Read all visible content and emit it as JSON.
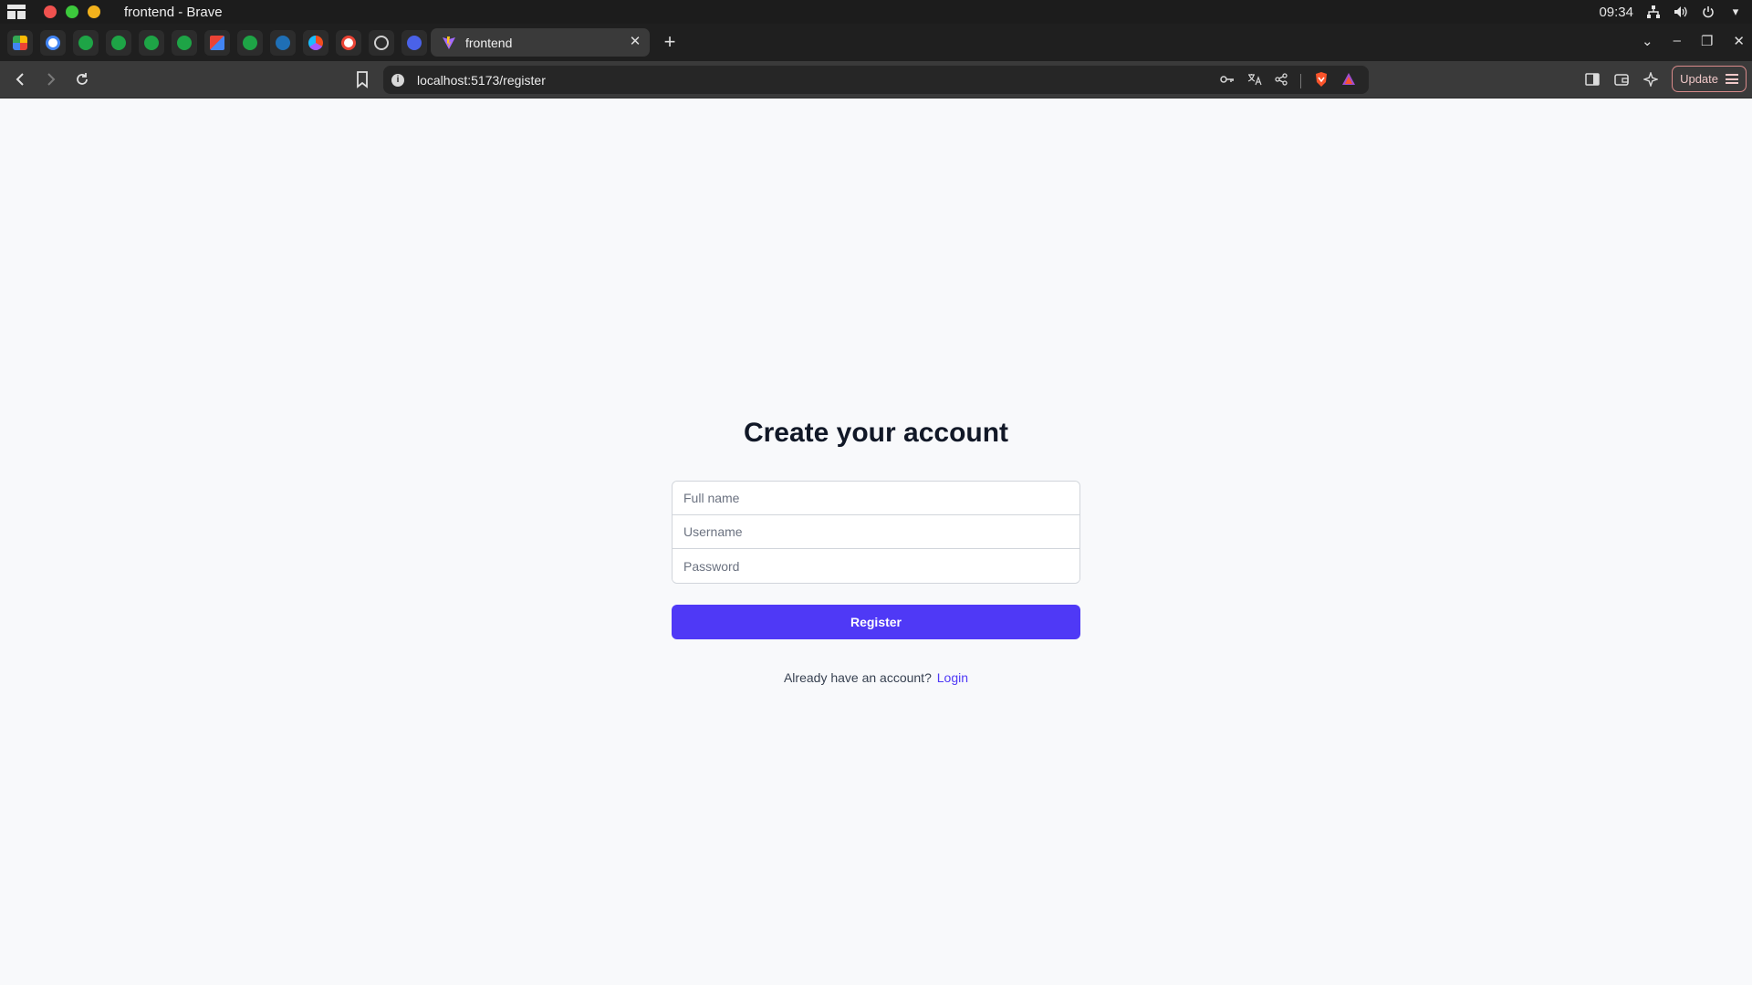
{
  "system": {
    "window_title": "frontend - Brave",
    "clock": "09:34"
  },
  "tabs": {
    "active_label": "frontend",
    "pinned_icons": [
      "google-photos-icon",
      "google-icon",
      "green-app-icon",
      "green-app-icon",
      "green-app-icon",
      "green-app-icon",
      "gmail-icon",
      "green-app-icon",
      "blue-app-icon",
      "figma-icon",
      "google-icon",
      "openai-icon",
      "blue-app-icon"
    ]
  },
  "toolbar": {
    "url": "localhost:5173/register",
    "update_label": "Update"
  },
  "page": {
    "heading": "Create your account",
    "fullname_placeholder": "Full name",
    "username_placeholder": "Username",
    "password_placeholder": "Password",
    "register_label": "Register",
    "login_prompt": "Already have an account?",
    "login_link": "Login"
  },
  "colors": {
    "accent": "#4f39f6",
    "page_bg": "#f8f9fb",
    "heading": "#111827"
  }
}
